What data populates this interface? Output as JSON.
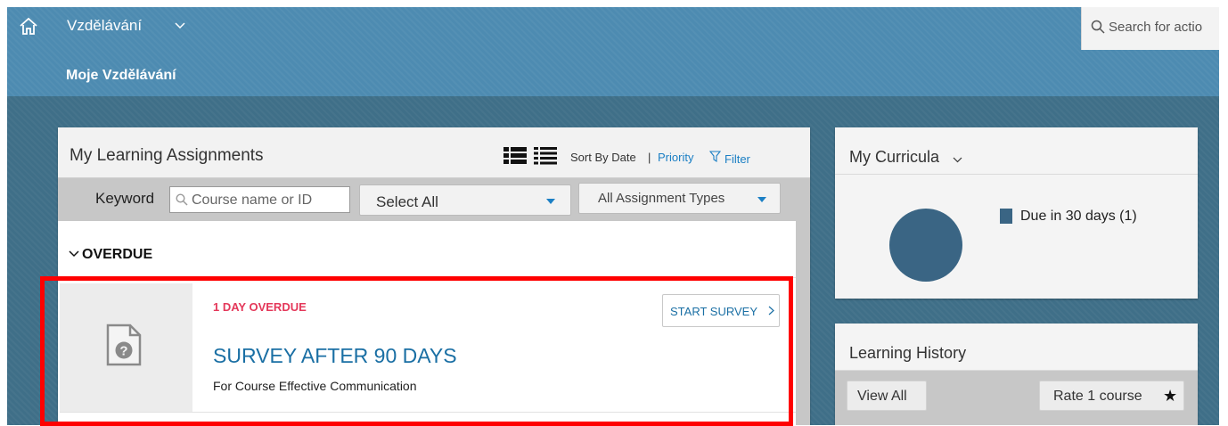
{
  "header": {
    "app_name": "Vzdělávání",
    "search_placeholder": "Search for actio",
    "page_title": "Moje Vzdělávání"
  },
  "assignments": {
    "title": "My Learning Assignments",
    "sort_by": "Sort By Date",
    "sort_separator": "|",
    "sort_priority": "Priority",
    "filter_label": "Filter",
    "keyword_label": "Keyword",
    "keyword_placeholder": "Course name or ID",
    "select_all": "Select All",
    "assignment_types": "All Assignment Types",
    "section_label": "OVERDUE",
    "items": [
      {
        "status": "1 DAY OVERDUE",
        "action": "START SURVEY",
        "title": "SURVEY AFTER 90 DAYS",
        "subtitle": "For Course Effective Communication"
      }
    ]
  },
  "curricula": {
    "title": "My Curricula",
    "legend_label": "Due in 30 days (1)",
    "color": "#3a6584"
  },
  "history": {
    "title": "Learning History",
    "view_all": "View All",
    "rate_label": "Rate 1 course",
    "star": "★"
  },
  "chart_data": {
    "type": "pie",
    "categories": [
      "Due in 30 days"
    ],
    "values": [
      1
    ],
    "title": "",
    "legend": "right"
  },
  "colors": {
    "brand": "#4d8bb1",
    "link": "#1a6fa4",
    "overdue": "#e4385a",
    "highlight": "#ff0000"
  },
  "icons": [
    "home-icon",
    "chevron-down-icon",
    "search-icon",
    "grid-view-icon",
    "list-view-icon",
    "filter-icon",
    "survey-document-icon",
    "star-icon"
  ]
}
